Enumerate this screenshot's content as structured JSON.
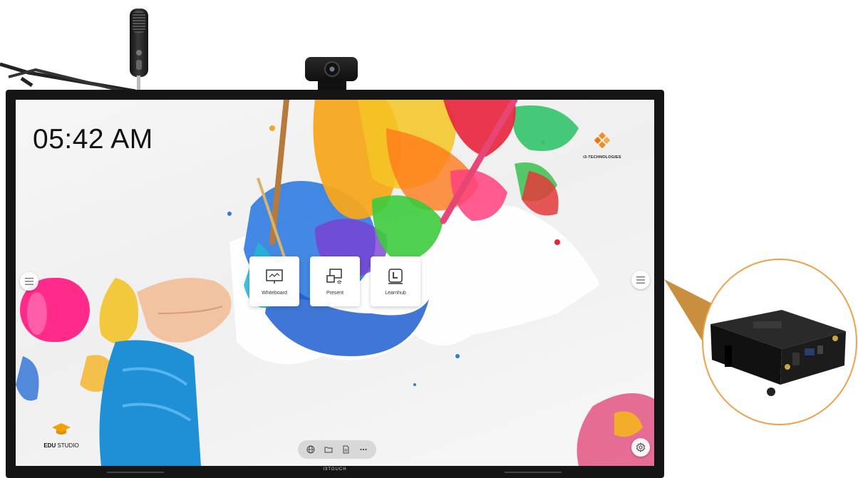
{
  "screen": {
    "clock": "05:42 AM",
    "brand_logo_text": "i3-TECHNOLOGIES",
    "apps": [
      {
        "label": "Whiteboard",
        "icon": "whiteboard-icon"
      },
      {
        "label": "Present",
        "icon": "present-icon"
      },
      {
        "label": "Learnhub",
        "icon": "learnhub-icon"
      }
    ],
    "edu_logo": {
      "bold": "EDU",
      "rest": " STUDIO"
    },
    "dock_icons": [
      "globe-icon",
      "folder-icon",
      "document-icon",
      "more-icon"
    ],
    "settings_icon": "gear-icon",
    "side_menu_icon": "hamburger-icon"
  },
  "bezel": {
    "brand": "I3TOUCH"
  },
  "colors": {
    "accent_orange": "#f0a04b",
    "edu_cap": "#f2a200",
    "i3_logo": "#f28c1b",
    "bezel": "#151515"
  }
}
